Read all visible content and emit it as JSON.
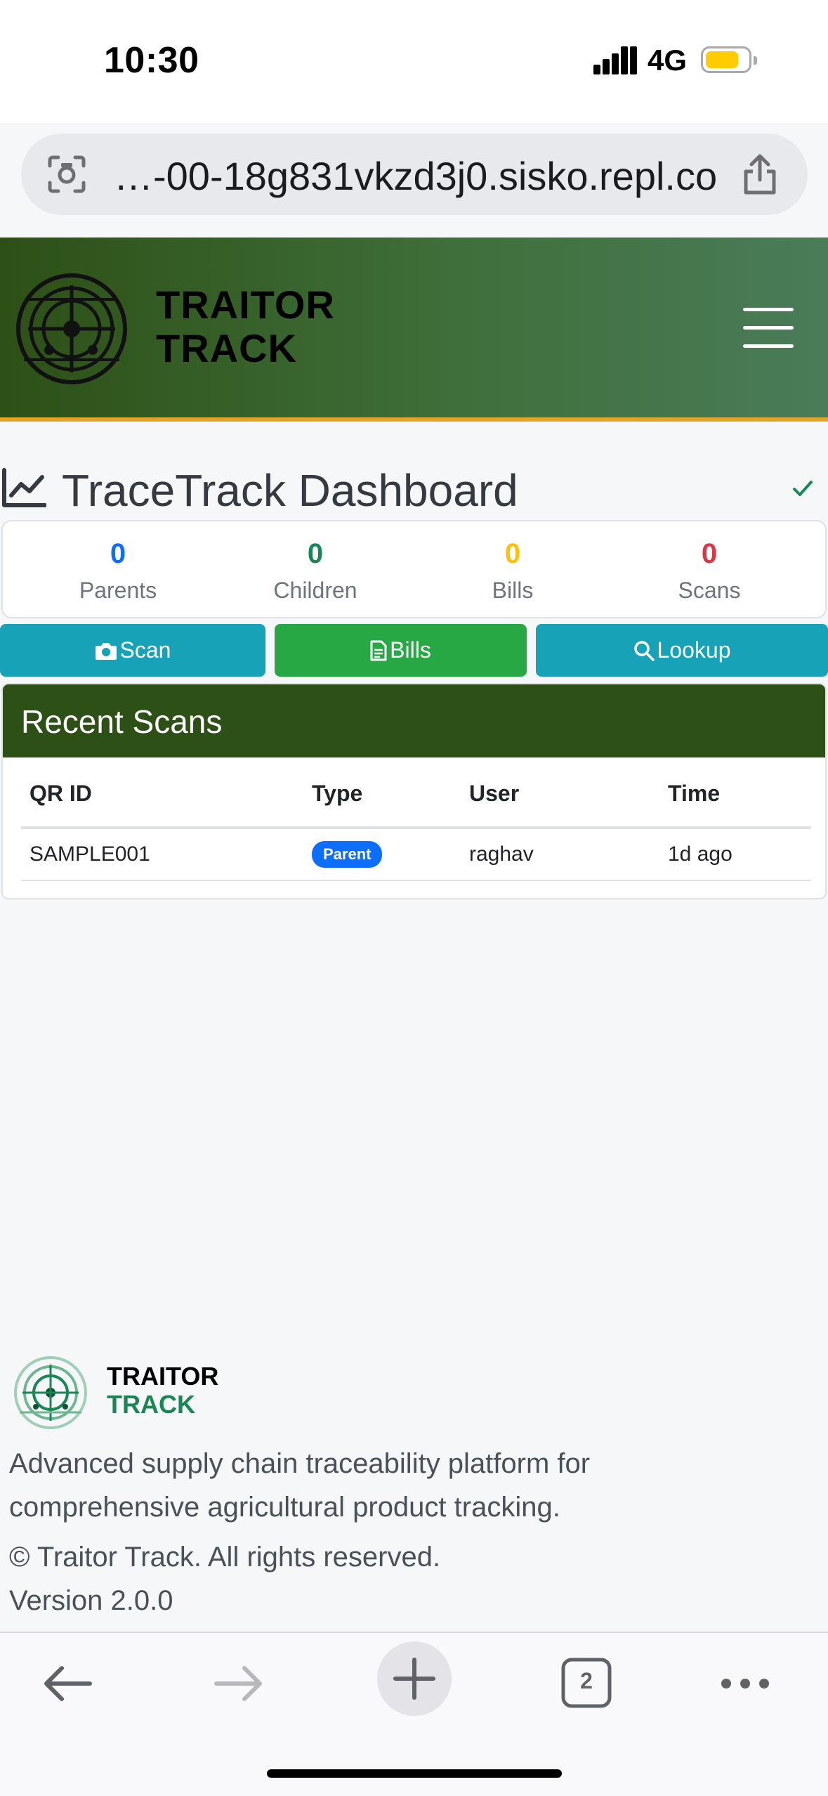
{
  "status_bar": {
    "time": "10:30",
    "network": "4G",
    "colors": {
      "battery": "#ffcc00"
    }
  },
  "url_bar": {
    "url": "…-00-18g831vkzd3j0.sisko.repl.co",
    "left_icon": "camera-scan-icon",
    "right_icon": "share-icon"
  },
  "header": {
    "brand_line1": "TRAITOR",
    "brand_line2": "TRACK",
    "menu_icon": "hamburger-menu-icon",
    "colors": {
      "gradient_start": "#2d5016",
      "gradient_end": "#4a7c59",
      "accent_border": "#e0a528"
    }
  },
  "page": {
    "title": "TraceTrack Dashboard",
    "title_icon": "line-chart-icon",
    "status_icon": "check-icon"
  },
  "stats": [
    {
      "value": "0",
      "label": "Parents",
      "color": "#0d6efd"
    },
    {
      "value": "0",
      "label": "Children",
      "color": "#198754"
    },
    {
      "value": "0",
      "label": "Bills",
      "color": "#ffc107"
    },
    {
      "value": "0",
      "label": "Scans",
      "color": "#dc3545"
    }
  ],
  "actions": [
    {
      "label": "Scan",
      "icon": "camera-icon",
      "color": "#17a2b8"
    },
    {
      "label": "Bills",
      "icon": "file-invoice-icon",
      "color": "#28a745"
    },
    {
      "label": "Lookup",
      "icon": "search-icon",
      "color": "#17a2b8"
    }
  ],
  "recent_scans": {
    "title": "Recent Scans",
    "columns": [
      "QR ID",
      "Type",
      "User",
      "Time"
    ],
    "rows": [
      {
        "qr_id": "SAMPLE001",
        "type": "Parent",
        "user": "raghav",
        "time": "1d ago"
      }
    ]
  },
  "footer": {
    "brand_line1": "TRAITOR",
    "brand_line2": "TRACK",
    "description": "Advanced supply chain traceability platform for comprehensive agricultural product tracking.",
    "copyright": "© Traitor Track. All rights reserved.",
    "version": "Version 2.0.0"
  },
  "browser_bar": {
    "tab_count": "2",
    "icons": [
      "back-arrow-icon",
      "forward-arrow-icon",
      "new-tab-plus-icon",
      "tabs-icon",
      "more-icon"
    ]
  }
}
